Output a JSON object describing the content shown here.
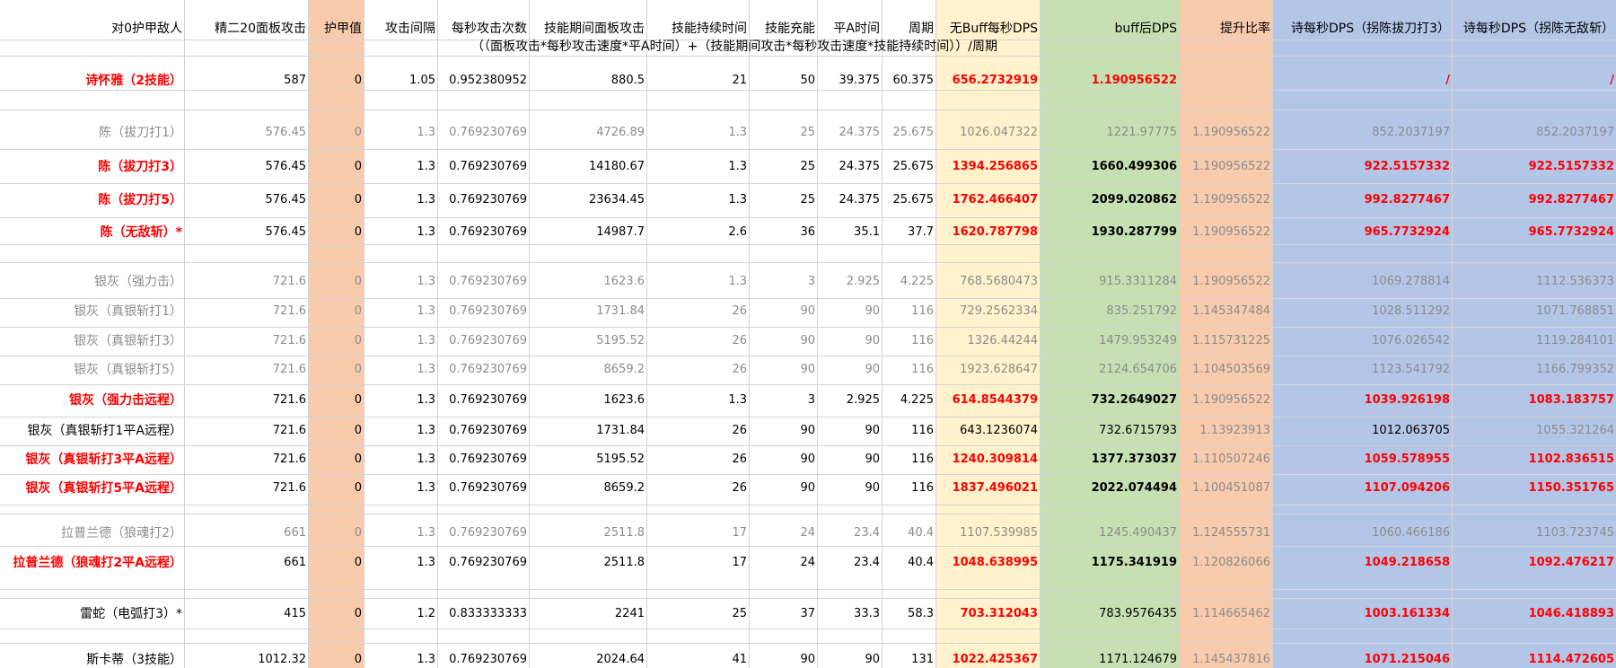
{
  "colors": {
    "armor": "#f8cbad",
    "no_buff_dps": "#fff2cc",
    "buff_dps": "#c6e0b4",
    "ratio": "#f8cbad",
    "shi_dps": "#b4c6e7",
    "red": "#ff0000",
    "gray": "#8c8c8c",
    "black": "#000000"
  },
  "header": [
    "对0护甲敌人",
    "精二20面板攻击",
    "护甲值",
    "攻击间隔",
    "每秒攻击次数",
    "技能期间面板攻击",
    "技能持续时间",
    "技能充能",
    "平A时间",
    "周期",
    "无Buff每秒DPS",
    "buff后DPS",
    "提升比率",
    "诗每秒DPS（拐陈拔刀打3）",
    "诗每秒DPS（拐陈无敌斩）"
  ],
  "formula": "（（面板攻击*每秒攻击速度*平A时间）+（技能期间攻击*每秒攻击速度*技能持续时间））/周期",
  "rows": [
    {
      "style": "red",
      "cells": [
        "诗怀雅（2技能）",
        "587",
        "0",
        "1.05",
        "0.952380952",
        "880.5",
        "21",
        "50",
        "39.375",
        "60.375",
        "656.2732919",
        "1.190956522",
        "",
        "/",
        "/"
      ]
    },
    {
      "style": "gray",
      "cells": [
        "陈（拔刀打1）",
        "576.45",
        "0",
        "1.3",
        "0.769230769",
        "4726.89",
        "1.3",
        "25",
        "24.375",
        "25.675",
        "1026.047322",
        "1221.97775",
        "1.190956522",
        "852.2037197",
        "852.2037197"
      ]
    },
    {
      "style": "red",
      "cells": [
        "陈（拔刀打3）",
        "576.45",
        "0",
        "1.3",
        "0.769230769",
        "14180.67",
        "1.3",
        "25",
        "24.375",
        "25.675",
        "1394.256865",
        "1660.499306",
        "1.190956522",
        "922.5157332",
        "922.5157332"
      ]
    },
    {
      "style": "red",
      "cells": [
        "陈（拔刀打5）",
        "576.45",
        "0",
        "1.3",
        "0.769230769",
        "23634.45",
        "1.3",
        "25",
        "24.375",
        "25.675",
        "1762.466407",
        "2099.020862",
        "1.190956522",
        "992.8277467",
        "992.8277467"
      ]
    },
    {
      "style": "red",
      "cells": [
        "陈（无敌斩）*",
        "576.45",
        "0",
        "1.3",
        "0.769230769",
        "14987.7",
        "2.6",
        "36",
        "35.1",
        "37.7",
        "1620.787798",
        "1930.287799",
        "1.190956522",
        "965.7732924",
        "965.7732924"
      ]
    },
    {
      "style": "gray",
      "cells": [
        "银灰（强力击）",
        "721.6",
        "0",
        "1.3",
        "0.769230769",
        "1623.6",
        "1.3",
        "3",
        "2.925",
        "4.225",
        "768.5680473",
        "915.3311284",
        "1.190956522",
        "1069.278814",
        "1112.536373"
      ]
    },
    {
      "style": "gray",
      "cells": [
        "银灰（真银斩打1）",
        "721.6",
        "0",
        "1.3",
        "0.769230769",
        "1731.84",
        "26",
        "90",
        "90",
        "116",
        "729.2562334",
        "835.251792",
        "1.145347484",
        "1028.511292",
        "1071.768851"
      ]
    },
    {
      "style": "gray",
      "cells": [
        "银灰（真银斩打3）",
        "721.6",
        "0",
        "1.3",
        "0.769230769",
        "5195.52",
        "26",
        "90",
        "90",
        "116",
        "1326.44244",
        "1479.953249",
        "1.115731225",
        "1076.026542",
        "1119.284101"
      ]
    },
    {
      "style": "gray",
      "cells": [
        "银灰（真银斩打5）",
        "721.6",
        "0",
        "1.3",
        "0.769230769",
        "8659.2",
        "26",
        "90",
        "90",
        "116",
        "1923.628647",
        "2124.654706",
        "1.104503569",
        "1123.541792",
        "1166.799352"
      ]
    },
    {
      "style": "red",
      "cells": [
        "银灰（强力击远程）",
        "721.6",
        "0",
        "1.3",
        "0.769230769",
        "1623.6",
        "1.3",
        "3",
        "2.925",
        "4.225",
        "614.8544379",
        "732.2649027",
        "1.190956522",
        "1039.926198",
        "1083.183757"
      ]
    },
    {
      "style": "black",
      "cells": [
        "银灰（真银斩打1平A远程）",
        "721.6",
        "0",
        "1.3",
        "0.769230769",
        "1731.84",
        "26",
        "90",
        "90",
        "116",
        "643.1236074",
        "732.6715793",
        "1.13923913",
        "1012.063705",
        "1055.321264"
      ]
    },
    {
      "style": "red",
      "cells": [
        "银灰（真银斩打3平A远程）",
        "721.6",
        "0",
        "1.3",
        "0.769230769",
        "5195.52",
        "26",
        "90",
        "90",
        "116",
        "1240.309814",
        "1377.373037",
        "1.110507246",
        "1059.578955",
        "1102.836515"
      ]
    },
    {
      "style": "red",
      "cells": [
        "银灰（真银斩打5平A远程）",
        "721.6",
        "0",
        "1.3",
        "0.769230769",
        "8659.2",
        "26",
        "90",
        "90",
        "116",
        "1837.496021",
        "2022.074494",
        "1.100451087",
        "1107.094206",
        "1150.351765"
      ]
    },
    {
      "style": "gray",
      "cells": [
        "拉普兰德（狼魂打2）",
        "661",
        "0",
        "1.3",
        "0.769230769",
        "2511.8",
        "17",
        "24",
        "23.4",
        "40.4",
        "1107.539985",
        "1245.490437",
        "1.124555731",
        "1060.466186",
        "1103.723745"
      ]
    },
    {
      "style": "red",
      "cells": [
        "拉普兰德（狼魂打2平A远程）",
        "661",
        "0",
        "1.3",
        "0.769230769",
        "2511.8",
        "17",
        "24",
        "23.4",
        "40.4",
        "1048.638995",
        "1175.341919",
        "1.120826066",
        "1049.218658",
        "1092.476217"
      ]
    },
    {
      "style": "black",
      "cells": [
        "雷蛇（电弧打3）*",
        "415",
        "0",
        "1.2",
        "0.833333333",
        "2241",
        "25",
        "37",
        "33.3",
        "58.3",
        "703.312043",
        "783.9576435",
        "1.114665462",
        "1003.161334",
        "1046.418893"
      ]
    },
    {
      "style": "black",
      "cells": [
        "斯卡蒂（3技能）",
        "1012.32",
        "0",
        "1.3",
        "0.769230769",
        "2024.64",
        "41",
        "90",
        "90",
        "131",
        "1022.425367",
        "1171.124679",
        "1.145437816",
        "1071.215046",
        "1114.472605"
      ]
    }
  ]
}
